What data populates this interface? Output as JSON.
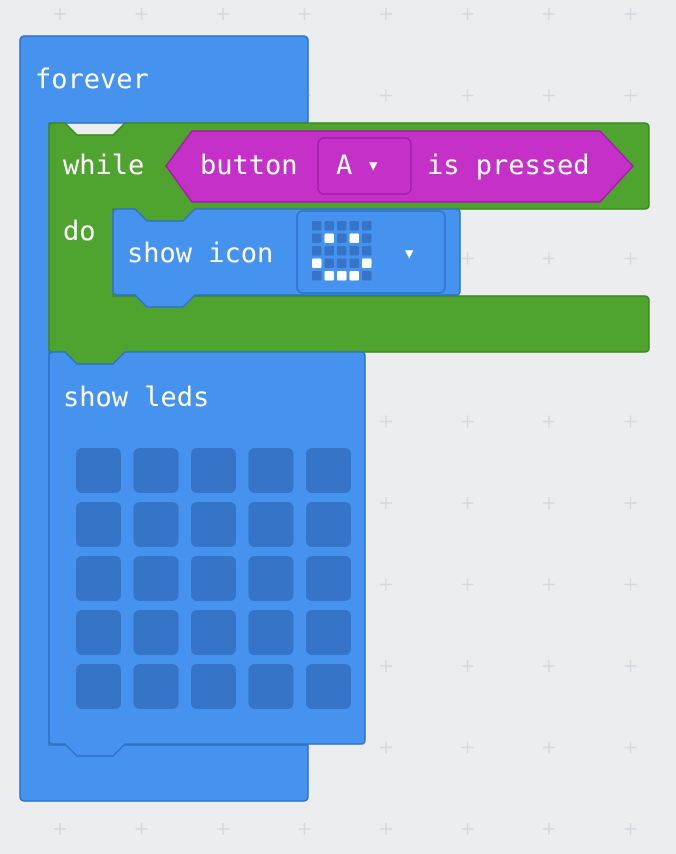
{
  "colors": {
    "workspace_bg": "#ecedef",
    "grid_plus": "#d6d8dc",
    "basic_block": "#4593ef",
    "basic_block_border": "#2f73c8",
    "loop_block": "#4ea42f",
    "loop_block_border": "#3b8a1f",
    "input_block": "#c530c9",
    "input_block_border": "#a21ea6",
    "led_off": "#3574c6",
    "led_on": "#ffffff"
  },
  "blocks": {
    "forever": {
      "label": "forever"
    },
    "while_loop": {
      "while_label": "while",
      "do_label": "do"
    },
    "button_condition": {
      "button_label": "button",
      "button_value": "A",
      "pressed_label": "is pressed"
    },
    "show_icon": {
      "label": "show icon",
      "icon_name": "smiley-icon",
      "icon_pattern": [
        [
          0,
          0,
          0,
          0,
          0
        ],
        [
          0,
          1,
          0,
          1,
          0
        ],
        [
          0,
          0,
          0,
          0,
          0
        ],
        [
          1,
          0,
          0,
          0,
          1
        ],
        [
          0,
          1,
          1,
          1,
          0
        ]
      ]
    },
    "show_leds": {
      "label": "show leds",
      "leds": [
        [
          0,
          0,
          0,
          0,
          0
        ],
        [
          0,
          0,
          0,
          0,
          0
        ],
        [
          0,
          0,
          0,
          0,
          0
        ],
        [
          0,
          0,
          0,
          0,
          0
        ],
        [
          0,
          0,
          0,
          0,
          0
        ]
      ]
    }
  }
}
